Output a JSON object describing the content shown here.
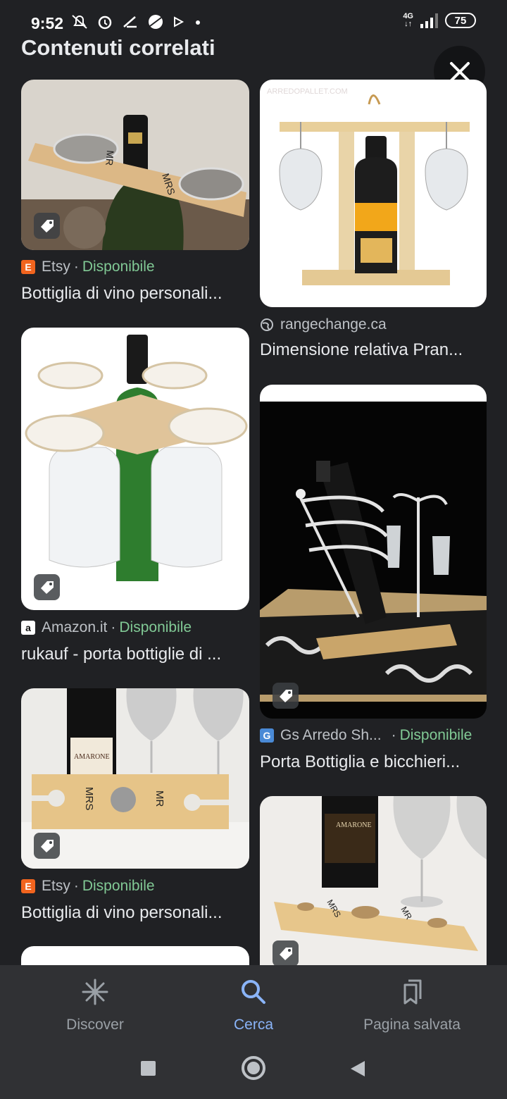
{
  "status_bar": {
    "time": "9:52",
    "network": "4G",
    "battery": "75"
  },
  "section": {
    "title": "Contenuti correlati"
  },
  "results": [
    {
      "id": "r1",
      "source": "Etsy",
      "availability": "Disponibile",
      "caption": "Bottiglia di vino personali...",
      "favicon": "etsy-icon",
      "favicon_letter": "E",
      "favicon_color": "#f1641e"
    },
    {
      "id": "r2",
      "source": "rangechange.ca",
      "availability": "",
      "caption": "Dimensione relativa Pran...",
      "favicon": "globe-icon"
    },
    {
      "id": "r3",
      "source": "Amazon.it",
      "availability": "Disponibile",
      "caption": "rukauf - porta bottiglie di ...",
      "favicon": "amazon-icon",
      "favicon_letter": "a"
    },
    {
      "id": "r4",
      "source": "Gs Arredo Sh...",
      "availability": "Disponibile",
      "caption": "Porta Bottiglia e bicchieri...",
      "favicon": "gs-arredo-icon",
      "favicon_letter": "G"
    },
    {
      "id": "r5",
      "source": "Etsy",
      "availability": "Disponibile",
      "caption": "Bottiglia di vino personali...",
      "favicon": "etsy-icon",
      "favicon_letter": "E",
      "favicon_color": "#f1641e"
    }
  ],
  "image_text": {
    "mrs": "MRS",
    "mr": "MR",
    "amarone": "AMARONE",
    "watermark": "ARREDOPALLET.COM"
  },
  "bottom_nav": {
    "discover": "Discover",
    "search": "Cerca",
    "saved": "Pagina salvata",
    "active": "Cerca",
    "active_color": "#8ab4f8"
  }
}
